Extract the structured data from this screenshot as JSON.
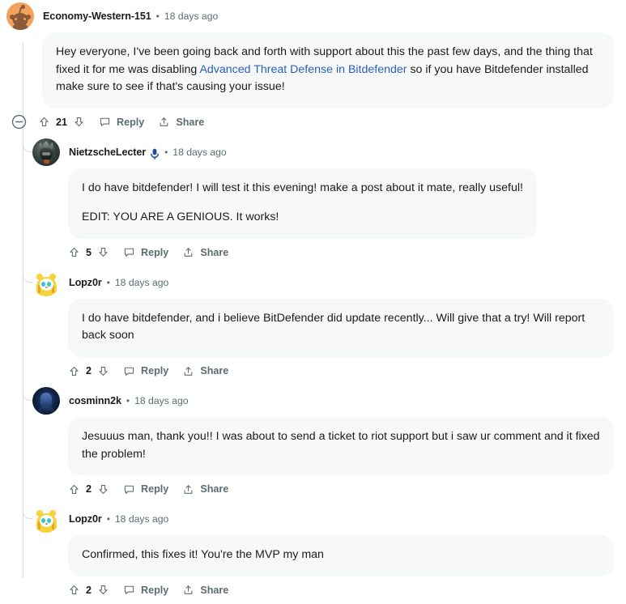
{
  "thread": {
    "root": {
      "author": "Economy-Western-151",
      "separator": "•",
      "timestamp": "18 days ago",
      "avatar": "snoo-avatar",
      "body_before_link": "Hey everyone, I've been going back and forth with support about this the past few days, and the thing that fixed it for me was disabling ",
      "link_text": "Advanced Threat Defense in Bitdefender",
      "body_after_link": " so if you have Bitdefender installed make sure to see if that's causing your issue!",
      "actions": {
        "collapse_icon": "collapse-minus-circle-icon",
        "upvote_icon": "upvote-arrow-icon",
        "score": "21",
        "downvote_icon": "downvote-arrow-icon",
        "reply_icon": "comment-bubble-icon",
        "reply_label": "Reply",
        "share_icon": "share-arrow-icon",
        "share_label": "Share"
      }
    },
    "replies": [
      {
        "author": "NietzscheLecter",
        "separator": "•",
        "timestamp": "18 days ago",
        "avatar": "knight-avatar",
        "badge_icon": "microphone-icon",
        "paragraphs": [
          "I do have bitdefender! I will test it this evening! make a post about it mate, really useful!",
          "EDIT: YOU ARE A GENIOUS. It works!"
        ],
        "actions": {
          "upvote_icon": "upvote-arrow-icon",
          "score": "5",
          "downvote_icon": "downvote-arrow-icon",
          "reply_icon": "comment-bubble-icon",
          "reply_label": "Reply",
          "share_icon": "share-arrow-icon",
          "share_label": "Share"
        }
      },
      {
        "author": "Lopz0r",
        "separator": "•",
        "timestamp": "18 days ago",
        "avatar": "cat-avatar",
        "badge_icon": null,
        "paragraphs": [
          "I do have bitdefender, and i believe BitDefender did update recently... Will give that a try! Will report back soon"
        ],
        "actions": {
          "upvote_icon": "upvote-arrow-icon",
          "score": "2",
          "downvote_icon": "downvote-arrow-icon",
          "reply_icon": "comment-bubble-icon",
          "reply_label": "Reply",
          "share_icon": "share-arrow-icon",
          "share_label": "Share"
        }
      },
      {
        "author": "cosminn2k",
        "separator": "•",
        "timestamp": "18 days ago",
        "avatar": "nightface-avatar",
        "badge_icon": null,
        "paragraphs": [
          "Jesuuus man, thank you!! I was about to send a ticket to riot support but i saw ur comment and it fixed the problem!"
        ],
        "actions": {
          "upvote_icon": "upvote-arrow-icon",
          "score": "2",
          "downvote_icon": "downvote-arrow-icon",
          "reply_icon": "comment-bubble-icon",
          "reply_label": "Reply",
          "share_icon": "share-arrow-icon",
          "share_label": "Share"
        }
      },
      {
        "author": "Lopz0r",
        "separator": "•",
        "timestamp": "18 days ago",
        "avatar": "cat-avatar",
        "badge_icon": null,
        "paragraphs": [
          "Confirmed, this fixes it! You're the MVP my man"
        ],
        "actions": {
          "upvote_icon": "upvote-arrow-icon",
          "score": "2",
          "downvote_icon": "downvote-arrow-icon",
          "reply_icon": "comment-bubble-icon",
          "reply_label": "Reply",
          "share_icon": "share-arrow-icon",
          "share_label": "Share"
        }
      }
    ]
  },
  "colors": {
    "link": "#2a5fb8",
    "bubble_bg": "#f7f9f9",
    "meta_text": "#5c6c74",
    "thread_line": "#d9dddf",
    "badge_blue": "#1e4fa3"
  }
}
